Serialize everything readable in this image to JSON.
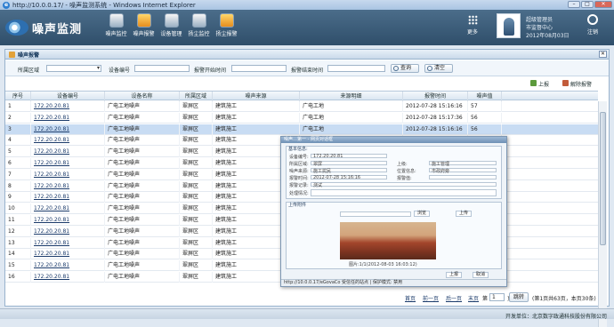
{
  "window": {
    "title": "http://10.0.0.17/ - 噪声监测系统 - Windows Internet Explorer",
    "controls": [
      "–",
      "□",
      "✕"
    ]
  },
  "header": {
    "logo_text": "噪声监测",
    "nav": [
      {
        "label": "噪声监控",
        "icon": "monitor-icon"
      },
      {
        "label": "噪声报警",
        "icon": "alarm-icon"
      },
      {
        "label": "设备管理",
        "icon": "device-icon"
      },
      {
        "label": "扬尘监控",
        "icon": "dust-monitor-icon"
      },
      {
        "label": "扬尘报警",
        "icon": "dust-alarm-icon"
      }
    ],
    "more_label": "更多",
    "user": {
      "name": "超级管理员",
      "org": "市监督中心",
      "date": "2012年08月03日"
    },
    "exit_label": "注销"
  },
  "panel": {
    "title": "噪声报警",
    "filter": {
      "area_label": "所属区域",
      "area_value": "",
      "device_label": "设备编号",
      "start_label": "报警开始时间",
      "end_label": "报警结束时间",
      "query_label": "查询",
      "clear_label": "清空"
    },
    "toolbar": {
      "report_label": "上报",
      "release_label": "解除报警"
    },
    "columns": [
      "序号",
      "设备编号",
      "设备名称",
      "所属区域",
      "噪声来源",
      "来源明细",
      "报警时间",
      "噪声值"
    ],
    "rows": [
      [
        "1",
        "172.20.20.81",
        "广电工地噪声",
        "翠屏区",
        "建筑施工",
        "广电工地",
        "2012-07-28 15:16:16",
        "57"
      ],
      [
        "2",
        "172.20.20.81",
        "广电工地噪声",
        "翠屏区",
        "建筑施工",
        "广电工地",
        "2012-07-28 15:17:36",
        "56"
      ],
      [
        "3",
        "172.20.20.81",
        "广电工地噪声",
        "翠屏区",
        "建筑施工",
        "广电工地",
        "2012-07-28 15:16:16",
        "56"
      ],
      [
        "4",
        "172.20.20.81",
        "广电工地噪声",
        "翠屏区",
        "建筑施工",
        "",
        "",
        ""
      ],
      [
        "5",
        "172.20.20.81",
        "广电工地噪声",
        "翠屏区",
        "建筑施工",
        "",
        "",
        ""
      ],
      [
        "6",
        "172.20.20.81",
        "广电工地噪声",
        "翠屏区",
        "建筑施工",
        "",
        "",
        ""
      ],
      [
        "7",
        "172.20.20.81",
        "广电工地噪声",
        "翠屏区",
        "建筑施工",
        "",
        "",
        ""
      ],
      [
        "8",
        "172.20.20.81",
        "广电工地噪声",
        "翠屏区",
        "建筑施工",
        "",
        "",
        ""
      ],
      [
        "9",
        "172.20.20.81",
        "广电工地噪声",
        "翠屏区",
        "建筑施工",
        "",
        "",
        ""
      ],
      [
        "10",
        "172.20.20.81",
        "广电工地噪声",
        "翠屏区",
        "建筑施工",
        "",
        "",
        ""
      ],
      [
        "11",
        "172.20.20.81",
        "广电工地噪声",
        "翠屏区",
        "建筑施工",
        "",
        "",
        ""
      ],
      [
        "12",
        "172.20.20.81",
        "广电工地噪声",
        "翠屏区",
        "建筑施工",
        "",
        "",
        ""
      ],
      [
        "13",
        "172.20.20.81",
        "广电工地噪声",
        "翠屏区",
        "建筑施工",
        "",
        "",
        ""
      ],
      [
        "14",
        "172.20.20.81",
        "广电工地噪声",
        "翠屏区",
        "建筑施工",
        "",
        "",
        ""
      ],
      [
        "15",
        "172.20.20.81",
        "广电工地噪声",
        "翠屏区",
        "建筑施工",
        "",
        "",
        ""
      ],
      [
        "16",
        "172.20.20.81",
        "广电工地噪声",
        "翠屏区",
        "建筑施工",
        "",
        "",
        ""
      ]
    ],
    "selected_row": 3,
    "pager": {
      "first": "首页",
      "prev": "前一页",
      "next": "后一页",
      "last": "末页",
      "page_prefix": "第",
      "page_value": "1",
      "page_suffix": "页",
      "go_label": "跳转",
      "info": "(第1页共63页，本页30条)"
    }
  },
  "popup": {
    "title": "噪声…第一 - 网页对话框",
    "basic_title": "基本信息:",
    "fields": {
      "device_no_label": "设备编号:",
      "device_no_value": "172.20.20.81",
      "area_label": "所属区域:",
      "area_value": "翠屏",
      "supervisor_label": "上级:",
      "supervisor_value": "施工管理",
      "source_label": "噪声来源:",
      "source_value": "施工扰民",
      "position_label": "位置信息:",
      "position_value": "市政府旁",
      "time_label": "报警时间:",
      "time_value": "2012-07-28 15:16:16",
      "value_label": "报警值:",
      "value_value": "",
      "record_label": "报警记录:",
      "record_value": "测试",
      "remark_label": "处理情况:"
    },
    "attach_title": "上传附件",
    "browse_label": "浏览",
    "upload_label": "上传",
    "caption": "图片:1/1(2012-08-03 16:03:12)",
    "report_label": "上报",
    "cancel_label": "取消",
    "status": "http://10.0.0.17/eGovaCo  受信任的站点 | 保护模式: 禁用"
  },
  "footer": {
    "text": "开发单位：北京数字政通科技股份有限公司"
  }
}
